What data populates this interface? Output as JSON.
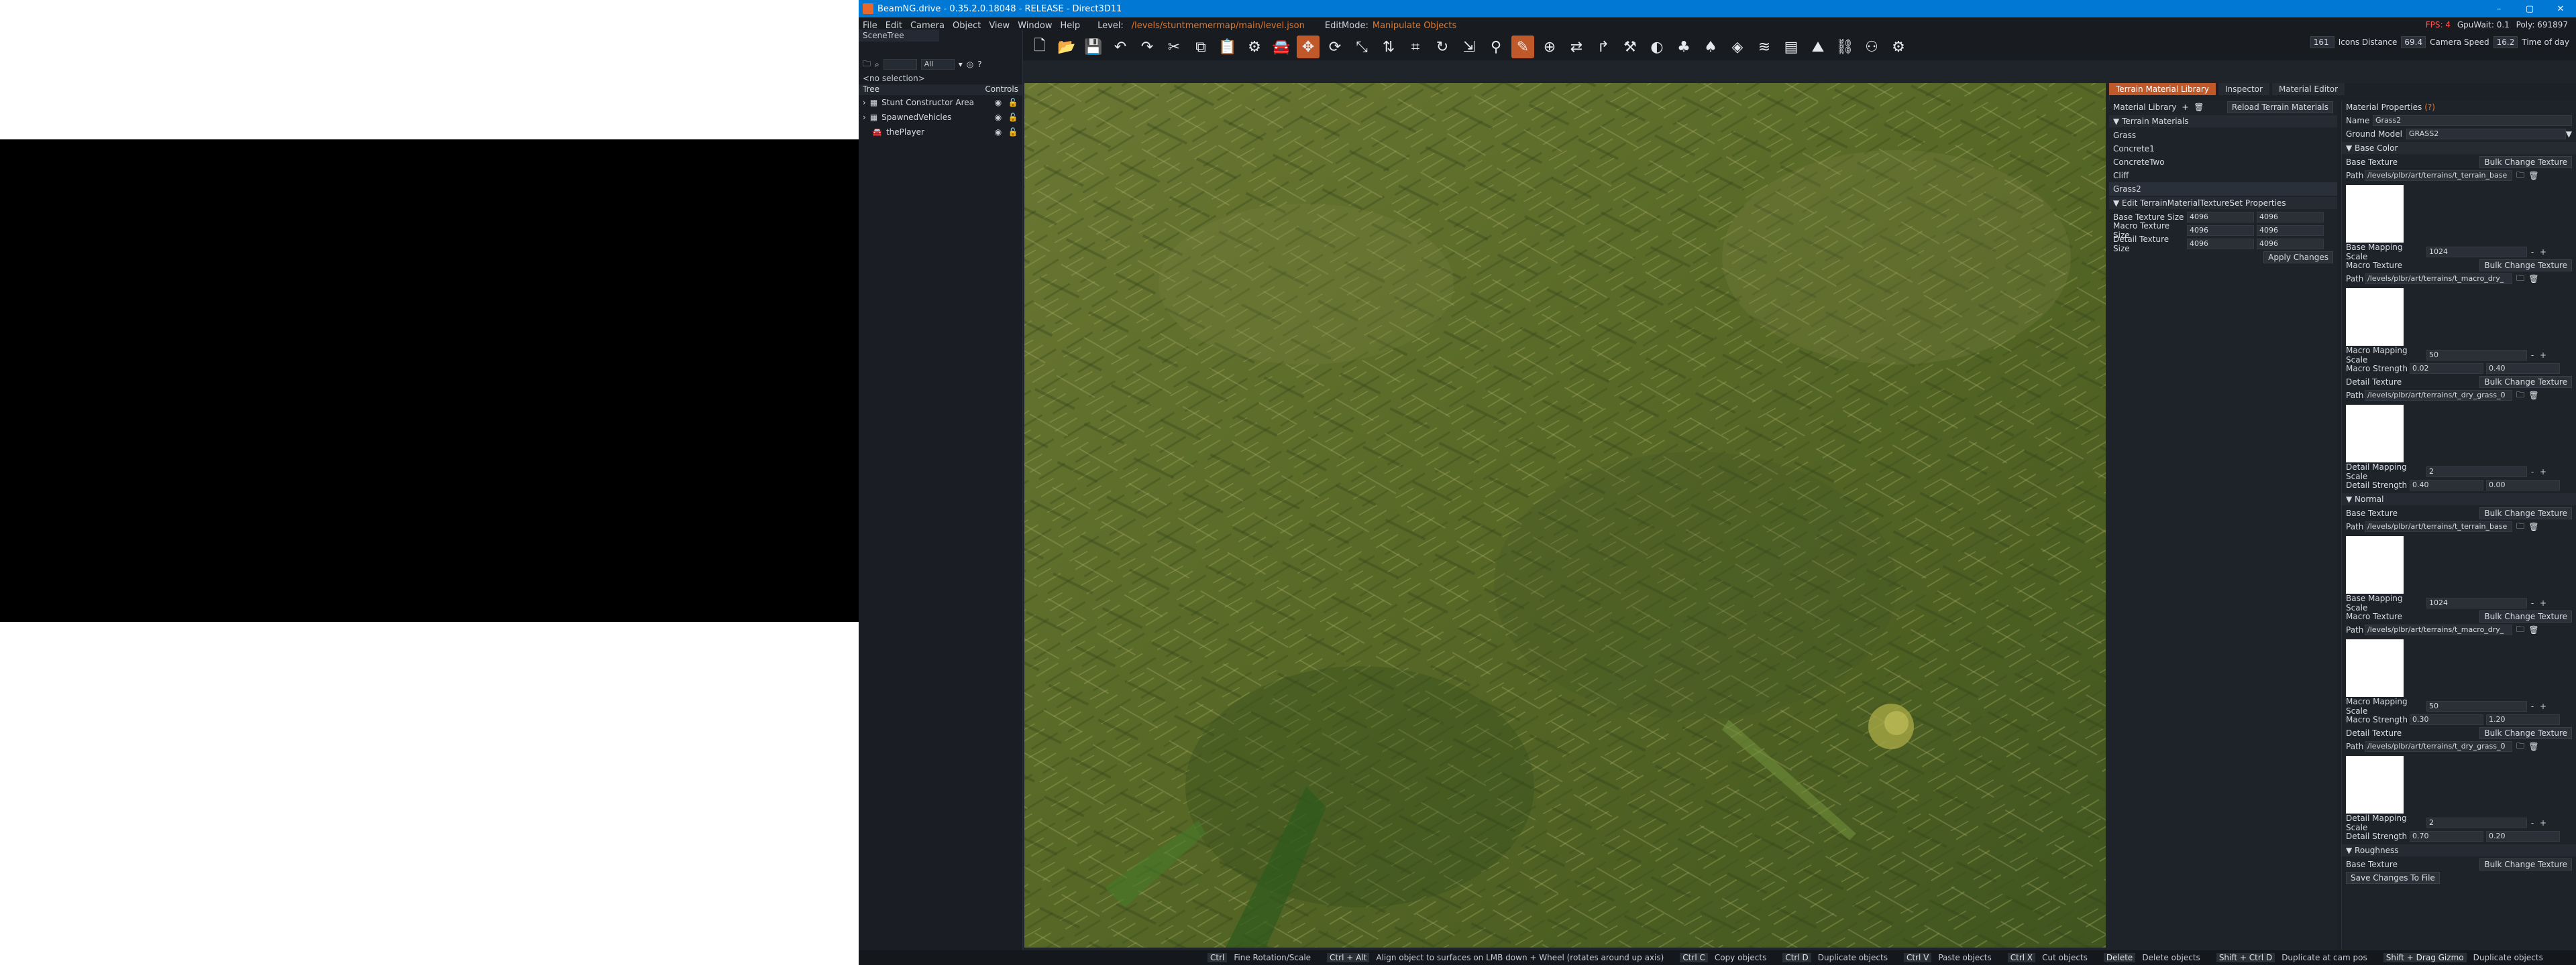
{
  "window": {
    "title": "BeamNG.drive - 0.35.2.0.18048 - RELEASE - Direct3D11",
    "controls": [
      "–",
      "▢",
      "✕"
    ]
  },
  "menu": {
    "items": [
      "File",
      "Edit",
      "Camera",
      "Object",
      "View",
      "Window",
      "Help"
    ],
    "level_label": "Level:",
    "level_path": "/levels/stuntmemermap/main/level.json",
    "editmode_label": "EditMode:",
    "editmode_value": "Manipulate Objects",
    "fps": "FPS: 4",
    "gpu_wait": "GpuWait: 0.1",
    "polys": "Poly: 691897"
  },
  "toolbar_right": {
    "value1": "161",
    "icons_distance_label": "Icons Distance",
    "icons_distance_value": "69.4",
    "camera_speed_label": "Camera Speed",
    "camera_speed_value": "16.2",
    "time_of_day_label": "Time of day"
  },
  "scenetree": {
    "tab": "SceneTree",
    "filter_value": "All",
    "no_selection": "<no selection>",
    "header_tree": "Tree",
    "header_controls": "Controls",
    "rows": [
      {
        "label": "Stunt Constructor Area"
      },
      {
        "label": "SpawnedVehicles"
      },
      {
        "label": "thePlayer"
      }
    ]
  },
  "right_tabs": [
    "Terrain Material Library",
    "Inspector",
    "Material Editor"
  ],
  "matlib": {
    "title": "Material Library",
    "reload": "Reload Terrain Materials",
    "section": "Terrain Materials",
    "materials": [
      "Grass",
      "Concrete1",
      "ConcreteTwo",
      "Cliff",
      "Grass2"
    ],
    "texset_section": "Edit TerrainMaterialTextureSet Properties",
    "texset_rows": [
      {
        "label": "Base Texture Size",
        "a": "4096",
        "b": "4096"
      },
      {
        "label": "Macro Texture Size",
        "a": "4096",
        "b": "4096"
      },
      {
        "label": "Detail Texture Size",
        "a": "4096",
        "b": "4096"
      }
    ],
    "apply": "Apply Changes"
  },
  "matprops": {
    "title": "Material Properties",
    "help": "(?)",
    "name_label": "Name",
    "name_value": "Grass2",
    "ground_model_label": "Ground Model",
    "ground_model_value": "GRASS2",
    "base_color_section": "Base Color",
    "normal_section": "Normal",
    "roughness_section": "Roughness",
    "base_texture": "Base Texture",
    "macro_texture": "Macro Texture",
    "detail_texture": "Detail Texture",
    "bulk": "Bulk Change Texture",
    "path_label": "Path",
    "path_terrain_base": "/levels/plbr/art/terrains/t_terrain_base",
    "path_macro": "/levels/plbr/art/terrains/t_macro_dry_",
    "path_detail": "/levels/plbr/art/terrains/t_dry_grass_0",
    "base_mapping_label": "Base Mapping Scale",
    "base_mapping_value": "1024",
    "macro_mapping_label": "Macro Mapping Scale",
    "macro_mapping_value": "50",
    "macro_strength_label": "Macro Strength",
    "detail_mapping_label": "Detail Mapping Scale",
    "detail_mapping_value": "2",
    "detail_strength_label": "Detail Strength",
    "bc_macro_strength_a": "0.02",
    "bc_macro_strength_b": "0.40",
    "bc_detail_strength_a": "0.40",
    "bc_detail_strength_b": "0.00",
    "n_macro_strength_a": "0.30",
    "n_macro_strength_b": "1.20",
    "n_detail_strength_a": "0.70",
    "n_detail_strength_b": "0.20",
    "save": "Save Changes To File"
  },
  "statusbar": [
    {
      "key": "Ctrl",
      "hint": "Fine Rotation/Scale"
    },
    {
      "key": "Ctrl + Alt",
      "hint": "Align object to surfaces on LMB down + Wheel (rotates around up axis)"
    },
    {
      "key": "Ctrl C",
      "hint": "Copy objects"
    },
    {
      "key": "Ctrl D",
      "hint": "Duplicate objects"
    },
    {
      "key": "Ctrl V",
      "hint": "Paste objects"
    },
    {
      "key": "Ctrl X",
      "hint": "Cut objects"
    },
    {
      "key": "Delete",
      "hint": "Delete objects"
    },
    {
      "key": "Shift + Ctrl D",
      "hint": "Duplicate at cam pos"
    },
    {
      "key": "Shift + Drag Gizmo",
      "hint": "Duplicate objects"
    }
  ]
}
